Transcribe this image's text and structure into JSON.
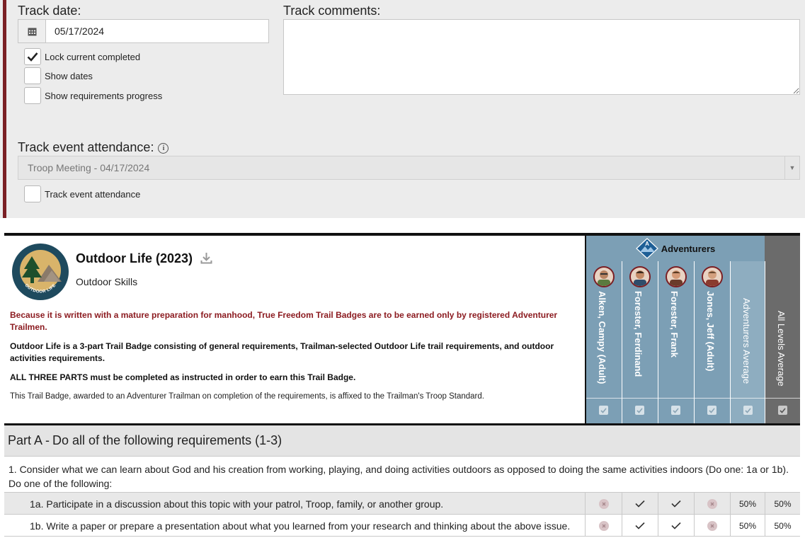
{
  "track_date": {
    "label": "Track date:",
    "value": "05/17/2024"
  },
  "track_comments": {
    "label": "Track comments:",
    "value": ""
  },
  "options": [
    {
      "label": "Lock current completed",
      "checked": true
    },
    {
      "label": "Show dates",
      "checked": false
    },
    {
      "label": "Show requirements progress",
      "checked": false
    }
  ],
  "attendance": {
    "label": "Track event attendance:",
    "selected": "Troop Meeting - 04/17/2024",
    "checkbox_label": "Track event attendance",
    "checked": false
  },
  "badge": {
    "title": "Outdoor Life (2023)",
    "logo_text": "OUTDOOR LIFE",
    "category": "Outdoor Skills",
    "notice": "Because it is written with a mature preparation for manhood, True Freedom Trail Badges are to be earned only by registered Adventurer Trailmen.",
    "description": "Outdoor Life is a 3-part Trail Badge consisting of general requirements, Trailman-selected Outdoor Life trail requirements, and outdoor activities requirements.",
    "emphasis": "ALL THREE PARTS must be completed as instructed in order to earn this Trail Badge.",
    "award": "This Trail Badge, awarded to an Adventurer Trailman on completion of the requirements, is affixed to the Trailman's Troop Standard."
  },
  "grid": {
    "group_name": "Adventurers",
    "members": [
      {
        "name": "Alken, Campy (Adult)"
      },
      {
        "name": "Forester, Ferdinand"
      },
      {
        "name": "Forester, Frank"
      },
      {
        "name": "Jones, Jeff (Adult)"
      }
    ],
    "group_average_label": "Adventurers Average",
    "all_average_label": "All Levels Average",
    "colors": {
      "group": "#7c9fb5",
      "all": "#6b6b6b",
      "accent": "#7a1f24"
    }
  },
  "part_a": {
    "title_prefix": "Part A - ",
    "title_rest": "Do all of the following requirements (1-3)",
    "requirement_1": "1.   Consider what we can learn about God and his creation from working, playing, and doing activities outdoors as opposed to doing the same activities indoors (Do one: 1a or 1b). Do one of the following:",
    "rows": [
      {
        "label": "1a.   Participate in a discussion about this topic with your patrol, Troop, family, or another group.",
        "status": [
          "not-done",
          "done",
          "done",
          "not-done"
        ],
        "group_avg": "50%",
        "all_avg": "50%"
      },
      {
        "label": "1b.   Write a paper or prepare a presentation about what you learned from your research and thinking about the above issue.",
        "status": [
          "not-done",
          "done",
          "done",
          "not-done"
        ],
        "group_avg": "50%",
        "all_avg": "50%"
      }
    ]
  }
}
